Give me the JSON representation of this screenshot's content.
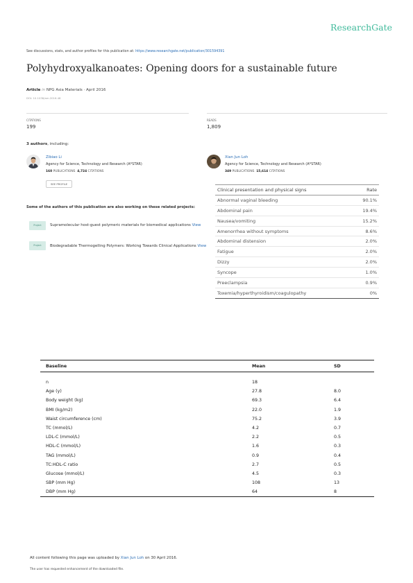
{
  "brand": "ResearchGate",
  "discussion": {
    "prefix": "See discussions, stats, and author profiles for this publication at: ",
    "url": "https://www.researchgate.net/publication/301594391"
  },
  "publication": {
    "title": "Polyhydroxyalkanoates: Opening doors for a sustainable future",
    "type": "Article",
    "in": "in",
    "journal_date": "NPG Asia Materials · April 2016",
    "doi": "DOI: 10.1038/am.2016.48"
  },
  "stats": {
    "citations_label": "CITATIONS",
    "citations_value": "199",
    "reads_label": "READS",
    "reads_value": "1,809"
  },
  "authors_heading": {
    "count": "3 authors",
    "suffix": ", including:"
  },
  "authors": [
    {
      "name": "Zibiao Li",
      "affiliation": "Agency for Science, Technology and Research (A*STAR)",
      "publications": "160",
      "publications_label": "PUBLICATIONS",
      "citations": "4,724",
      "citations_label": "CITATIONS",
      "button": "SEE PROFILE"
    },
    {
      "name": "Xian Jun Loh",
      "affiliation": "Agency for Science, Technology and Research (A*STAR)",
      "publications": "349",
      "publications_label": "PUBLICATIONS",
      "citations": "15,614",
      "citations_label": "CITATIONS"
    }
  ],
  "projects_heading": "Some of the authors of this publication are also working on these related projects:",
  "projects": [
    {
      "badge": "Project",
      "text": "Supramolecular host-guest polymeric materials for biomedical applications",
      "link": "View"
    },
    {
      "badge": "Project",
      "text": "Biodegradable Thermogelling Polymers: Working Towards Clinical Applications",
      "link": "View"
    }
  ],
  "clinical_table": {
    "headers": [
      "Clinical presentation and physical signs",
      "Rate"
    ],
    "rows": [
      [
        "Abnormal vaginal bleeding",
        "90.1%"
      ],
      [
        "Abdominal pain",
        "19.4%"
      ],
      [
        "Nausea/vomiting",
        "15.2%"
      ],
      [
        "Amenorrhea without symptoms",
        "8.6%"
      ],
      [
        "Abdominal distension",
        "2.0%"
      ],
      [
        "Fatigue",
        "2.0%"
      ],
      [
        "Dizzy",
        "2.0%"
      ],
      [
        "Syncope",
        "1.0%"
      ],
      [
        "Preeclampsia",
        "0.9%"
      ],
      [
        "Toxemia/hyperthyroidism/coagulopathy",
        "0%"
      ]
    ]
  },
  "baseline_table": {
    "headers": [
      "Baseline",
      "Mean",
      "SD"
    ],
    "rows": [
      [
        "n",
        "18",
        ""
      ],
      [
        "Age (y)",
        "27.8",
        "8.0"
      ],
      [
        "Body weight (kg)",
        "69.3",
        "6.4"
      ],
      [
        "BMI (kg/m2)",
        "22.0",
        "1.9"
      ],
      [
        "Waist circumference (cm)",
        "75.2",
        "3.9"
      ],
      [
        "TC (mmol/L)",
        "4.2",
        "0.7"
      ],
      [
        "LDL-C (mmol/L)",
        "2.2",
        "0.5"
      ],
      [
        "HDL-C (mmol/L)",
        "1.6",
        "0.3"
      ],
      [
        "TAG (mmol/L)",
        "0.9",
        "0.4"
      ],
      [
        "TC:HDL-C ratio",
        "2.7",
        "0.5"
      ],
      [
        "Glucose (mmol/L)",
        "4.5",
        "0.3"
      ],
      [
        "SBP (mm Hg)",
        "108",
        "13"
      ],
      [
        "DBP (mm Hg)",
        "64",
        "8"
      ]
    ]
  },
  "footer": {
    "line1_prefix": "All content following this page was uploaded by ",
    "uploader": "Xian Jun Loh",
    "line1_suffix": " on 30 April 2016.",
    "line2": "The user has requested enhancement of the downloaded file."
  }
}
